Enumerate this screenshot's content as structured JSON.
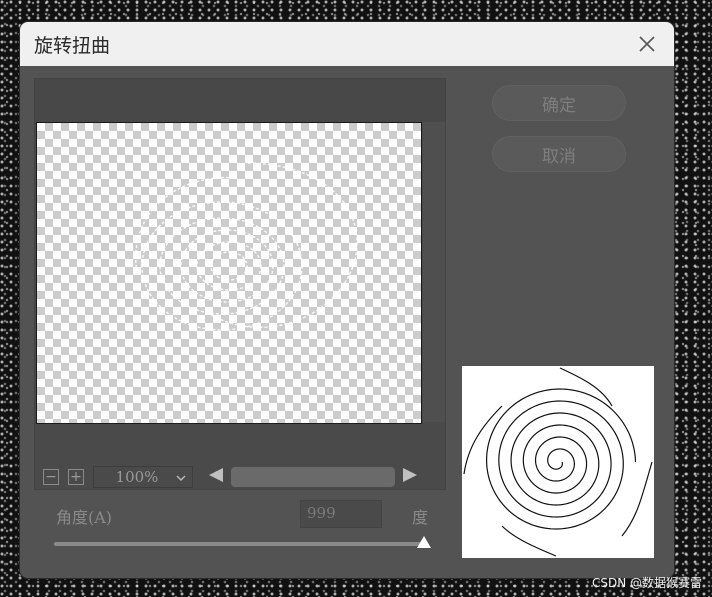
{
  "dialog": {
    "title": "旋转扭曲",
    "close_icon": "close-icon"
  },
  "buttons": {
    "ok_label": "确定",
    "cancel_label": "取消"
  },
  "preview": {
    "zoom_value": "100%",
    "zoom_out_icon": "minus-icon",
    "zoom_in_icon": "plus-icon",
    "zoom_out_glyph": "−",
    "zoom_in_glyph": "+",
    "dropdown_icon": "chevron-down-icon",
    "scroll_left_icon": "triangle-left-icon",
    "scroll_right_icon": "triangle-right-icon"
  },
  "angle": {
    "label": "角度(A)",
    "value": "999",
    "unit": "度",
    "slider_level": 1.0
  },
  "watermark": "CSDN @数据猴赛雷",
  "colors": {
    "dialog_bg": "#535353",
    "titlebar_bg": "#f0f0f0"
  }
}
